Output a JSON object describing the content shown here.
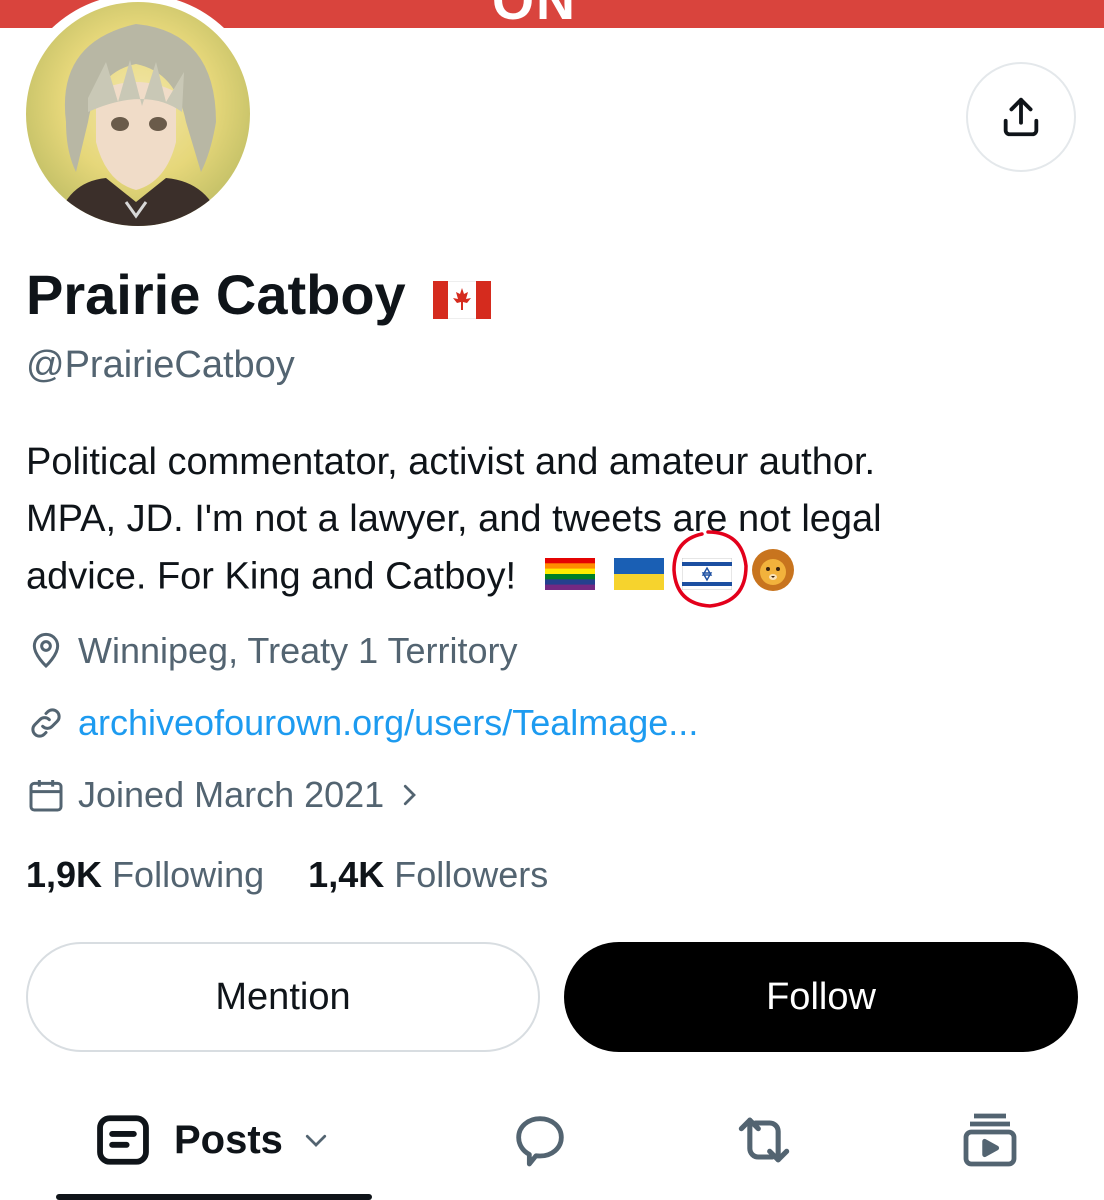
{
  "banner": {
    "text": "ON"
  },
  "profile": {
    "name": "Prairie Catboy",
    "handle": "@PrairieCatboy",
    "bio": [
      "Political commentator, activist and amateur author.",
      "MPA, JD. I'm not a lawyer, and tweets are not legal",
      "advice. For King and Catboy!"
    ],
    "location": "Winnipeg, Treaty 1 Territory",
    "website": "archiveofourown.org/users/Tealmage...",
    "joined": "Joined March 2021"
  },
  "stats": {
    "following_count": "1,9K",
    "following_label": "Following",
    "followers_count": "1,4K",
    "followers_label": "Followers"
  },
  "actions": {
    "mention_label": "Mention",
    "follow_label": "Follow"
  },
  "tabs": {
    "posts_label": "Posts"
  },
  "colors": {
    "banner": "#d9443d",
    "link": "#1d9bf0",
    "secondary_text": "#536471",
    "annotation_circle": "#e3001b"
  },
  "icons": [
    "share-icon",
    "canada-flag-icon",
    "pride-flag-icon",
    "ukraine-flag-icon",
    "israel-flag-icon",
    "lion-icon",
    "location-pin-icon",
    "link-icon",
    "calendar-icon",
    "chevron-right-icon",
    "posts-icon",
    "chevron-down-icon",
    "reply-icon",
    "repost-icon",
    "media-icon"
  ]
}
